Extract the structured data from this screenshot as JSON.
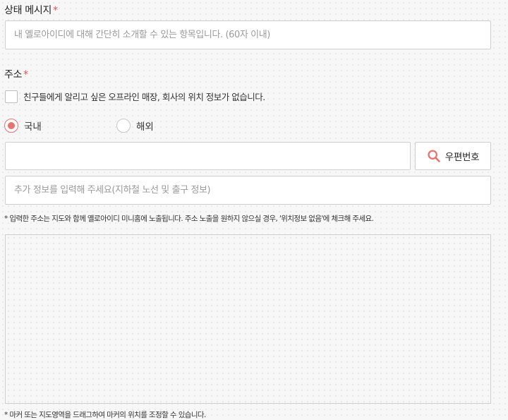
{
  "status": {
    "label": "상태 메시지",
    "required_mark": "*",
    "placeholder": "내 옐로아이디에 대해 간단히 소개할 수 있는 항목입니다. (60자 이내)",
    "value": ""
  },
  "address": {
    "label": "주소",
    "required_mark": "*",
    "no_location_checkbox": {
      "label": "친구들에게 알리고 싶은 오프라인 매장, 회사의 위치 정보가 없습니다.",
      "checked": false
    },
    "region_options": [
      {
        "label": "국내",
        "selected": true
      },
      {
        "label": "해외",
        "selected": false
      }
    ],
    "address_value": "",
    "zip_button_label": "우편번호",
    "detail_placeholder": "추가 정보를 입력해 주세요(지하철 노선 및 출구 정보)",
    "detail_value": "",
    "notice": "* 입력한 주소는 지도와 함께 옐로아이디 미니홈에 노출됩니다. 주소 노출을 원하지 않으실 경우, '위치정보 없음'에 체크해 주세요.",
    "map_notice": "* 마커 또는 지도영역을 드래그하여 마커의 위치를 조정할 수 있습니다."
  },
  "colors": {
    "required": "#e8534f",
    "radio_selected": "#e8736f",
    "search_icon": "#e8736f"
  },
  "icons": {
    "zip_button": "search-icon"
  }
}
